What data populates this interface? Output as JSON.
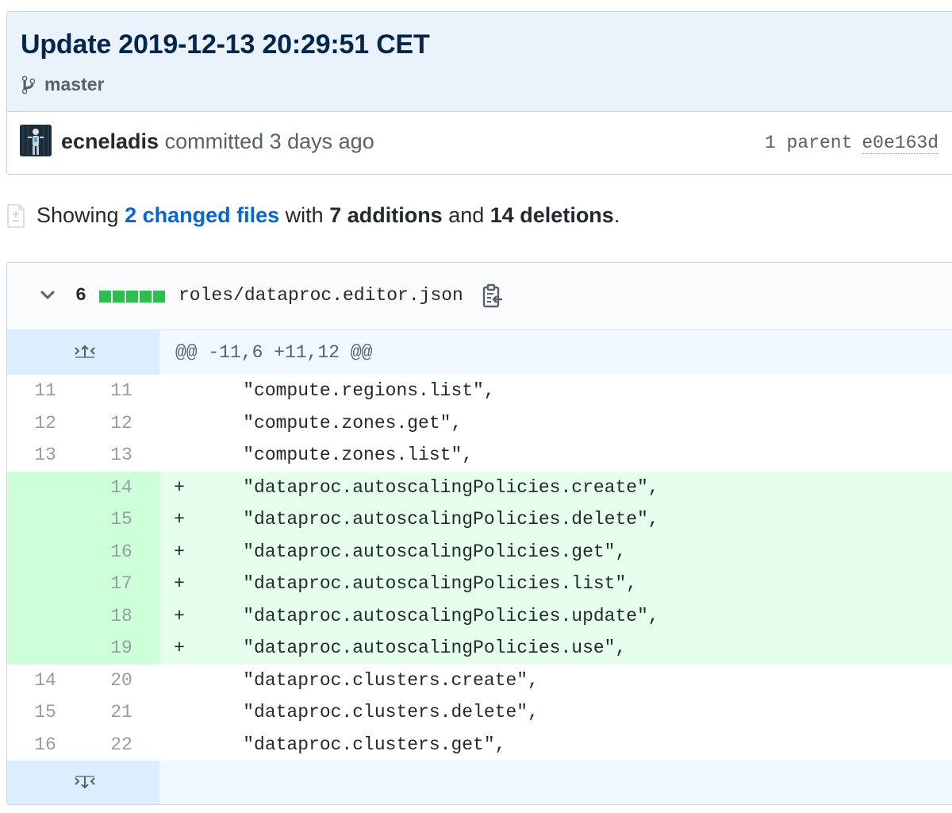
{
  "commit": {
    "title": "Update 2019-12-13 20:29:51 CET",
    "branch": "master",
    "author": "ecneladis",
    "committed_text": " committed 3 days ago",
    "parent_label": "1 parent",
    "parent_sha": "e0e163d"
  },
  "summary": {
    "prefix": "Showing ",
    "changed_files": "2 changed files",
    "with_text": " with ",
    "additions": "7 additions",
    "and_text": " and ",
    "deletions": "14 deletions",
    "suffix": "."
  },
  "file": {
    "change_count": "6",
    "diffstat_blocks": 5,
    "filename": "roles/dataproc.editor.json",
    "hunk_header": "@@ -11,6 +11,12 @@"
  },
  "diff_rows": [
    {
      "old": "11",
      "new": "11",
      "type": "context",
      "marker": "",
      "code": "    \"compute.regions.list\","
    },
    {
      "old": "12",
      "new": "12",
      "type": "context",
      "marker": "",
      "code": "    \"compute.zones.get\","
    },
    {
      "old": "13",
      "new": "13",
      "type": "context",
      "marker": "",
      "code": "    \"compute.zones.list\","
    },
    {
      "old": "",
      "new": "14",
      "type": "add",
      "marker": "+",
      "code": "    \"dataproc.autoscalingPolicies.create\","
    },
    {
      "old": "",
      "new": "15",
      "type": "add",
      "marker": "+",
      "code": "    \"dataproc.autoscalingPolicies.delete\","
    },
    {
      "old": "",
      "new": "16",
      "type": "add",
      "marker": "+",
      "code": "    \"dataproc.autoscalingPolicies.get\","
    },
    {
      "old": "",
      "new": "17",
      "type": "add",
      "marker": "+",
      "code": "    \"dataproc.autoscalingPolicies.list\","
    },
    {
      "old": "",
      "new": "18",
      "type": "add",
      "marker": "+",
      "code": "    \"dataproc.autoscalingPolicies.update\","
    },
    {
      "old": "",
      "new": "19",
      "type": "add",
      "marker": "+",
      "code": "    \"dataproc.autoscalingPolicies.use\","
    },
    {
      "old": "14",
      "new": "20",
      "type": "context",
      "marker": "",
      "code": "    \"dataproc.clusters.create\","
    },
    {
      "old": "15",
      "new": "21",
      "type": "context",
      "marker": "",
      "code": "    \"dataproc.clusters.delete\","
    },
    {
      "old": "16",
      "new": "22",
      "type": "context",
      "marker": "",
      "code": "    \"dataproc.clusters.get\","
    }
  ],
  "colors": {
    "addition_bg": "#e6ffed",
    "addition_gutter": "#cdffd8",
    "hunk_bg": "#f1f8ff",
    "link": "#0366d6",
    "diffstat_green": "#2cbe4e"
  },
  "icons": [
    "git-branch-icon",
    "file-diff-icon",
    "chevron-down-icon",
    "clipboard-icon",
    "unfold-up-icon",
    "unfold-down-icon"
  ]
}
